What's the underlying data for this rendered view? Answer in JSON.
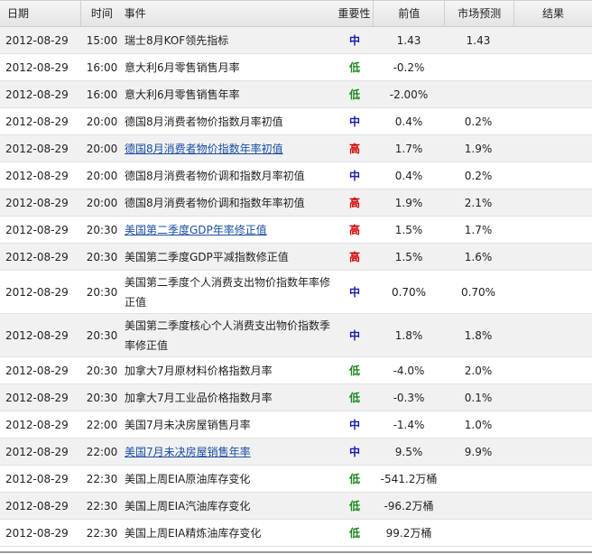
{
  "headers": {
    "date": "日期",
    "time": "时间",
    "event": "事件",
    "importance": "重要性",
    "previous": "前值",
    "forecast": "市场预测",
    "result": "结果"
  },
  "colors": {
    "high": "#d00000",
    "medium": "#1a1aa8",
    "low": "#1b8a1b",
    "link": "#1a4ea3"
  },
  "rows": [
    {
      "date": "2012-08-29",
      "time": "15:00",
      "event": "瑞士8月KOF领先指标",
      "importance": "中",
      "level": "mid",
      "previous": "1.43",
      "forecast": "1.43",
      "result": "",
      "link": false
    },
    {
      "date": "2012-08-29",
      "time": "16:00",
      "event": "意大利6月零售销售月率",
      "importance": "低",
      "level": "low",
      "previous": "-0.2%",
      "forecast": "",
      "result": "",
      "link": false
    },
    {
      "date": "2012-08-29",
      "time": "16:00",
      "event": "意大利6月零售销售年率",
      "importance": "低",
      "level": "low",
      "previous": "-2.00%",
      "forecast": "",
      "result": "",
      "link": false
    },
    {
      "date": "2012-08-29",
      "time": "20:00",
      "event": "德国8月消费者物价指数月率初值",
      "importance": "中",
      "level": "mid",
      "previous": "0.4%",
      "forecast": "0.2%",
      "result": "",
      "link": false
    },
    {
      "date": "2012-08-29",
      "time": "20:00",
      "event": "德国8月消费者物价指数年率初值",
      "importance": "高",
      "level": "high",
      "previous": "1.7%",
      "forecast": "1.9%",
      "result": "",
      "link": true
    },
    {
      "date": "2012-08-29",
      "time": "20:00",
      "event": "德国8月消费者物价调和指数月率初值",
      "importance": "中",
      "level": "mid",
      "previous": "0.4%",
      "forecast": "0.2%",
      "result": "",
      "link": false
    },
    {
      "date": "2012-08-29",
      "time": "20:00",
      "event": "德国8月消费者物价调和指数年率初值",
      "importance": "高",
      "level": "high",
      "previous": "1.9%",
      "forecast": "2.1%",
      "result": "",
      "link": false
    },
    {
      "date": "2012-08-29",
      "time": "20:30",
      "event": "美国第二季度GDP年率修正值",
      "importance": "高",
      "level": "high",
      "previous": "1.5%",
      "forecast": "1.7%",
      "result": "",
      "link": true
    },
    {
      "date": "2012-08-29",
      "time": "20:30",
      "event": "美国第二季度GDP平减指数修正值",
      "importance": "高",
      "level": "high",
      "previous": "1.5%",
      "forecast": "1.6%",
      "result": "",
      "link": false
    },
    {
      "date": "2012-08-29",
      "time": "20:30",
      "event": "美国第二季度个人消费支出物价指数年率修正值",
      "importance": "中",
      "level": "mid",
      "previous": "0.70%",
      "forecast": "0.70%",
      "result": "",
      "link": false,
      "tall": true
    },
    {
      "date": "2012-08-29",
      "time": "20:30",
      "event": "美国第二季度核心个人消费支出物价指数季率修正值",
      "importance": "中",
      "level": "mid",
      "previous": "1.8%",
      "forecast": "1.8%",
      "result": "",
      "link": false,
      "tall": true
    },
    {
      "date": "2012-08-29",
      "time": "20:30",
      "event": "加拿大7月原材料价格指数月率",
      "importance": "低",
      "level": "low",
      "previous": "-4.0%",
      "forecast": "2.0%",
      "result": "",
      "link": false
    },
    {
      "date": "2012-08-29",
      "time": "20:30",
      "event": "加拿大7月工业品价格指数月率",
      "importance": "低",
      "level": "low",
      "previous": "-0.3%",
      "forecast": "0.1%",
      "result": "",
      "link": false
    },
    {
      "date": "2012-08-29",
      "time": "22:00",
      "event": "美国7月未决房屋销售月率",
      "importance": "中",
      "level": "mid",
      "previous": "-1.4%",
      "forecast": "1.0%",
      "result": "",
      "link": false
    },
    {
      "date": "2012-08-29",
      "time": "22:00",
      "event": "美国7月未决房屋销售年率",
      "importance": "中",
      "level": "mid",
      "previous": "9.5%",
      "forecast": "9.9%",
      "result": "",
      "link": true
    },
    {
      "date": "2012-08-29",
      "time": "22:30",
      "event": "美国上周EIA原油库存变化",
      "importance": "低",
      "level": "low",
      "previous": "-541.2万桶",
      "forecast": "",
      "result": "",
      "link": false
    },
    {
      "date": "2012-08-29",
      "time": "22:30",
      "event": "美国上周EIA汽油库存变化",
      "importance": "低",
      "level": "low",
      "previous": "-96.2万桶",
      "forecast": "",
      "result": "",
      "link": false
    },
    {
      "date": "2012-08-29",
      "time": "22:30",
      "event": "美国上周EIA精炼油库存变化",
      "importance": "低",
      "level": "low",
      "previous": "99.2万桶",
      "forecast": "",
      "result": "",
      "link": false
    }
  ]
}
